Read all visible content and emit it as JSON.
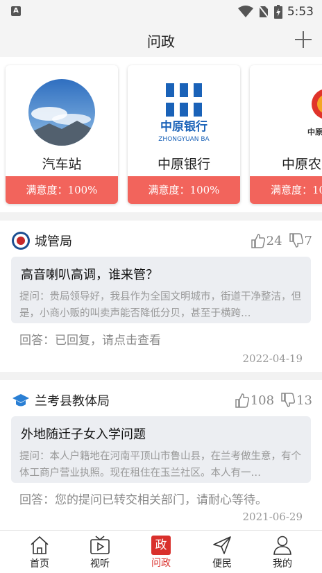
{
  "status": {
    "time": "5:53",
    "left_icon": "A"
  },
  "header": {
    "title": "问政",
    "add_icon": "plus-icon"
  },
  "cards": [
    {
      "name": "汽车站",
      "satisfaction": "满意度：100%",
      "logo": "sky-mountain-photo"
    },
    {
      "name": "中原银行",
      "satisfaction": "满意度：100%",
      "logo": "zhongyuan-bank-logo",
      "logo_text": "中原银行",
      "logo_sub": "ZHONGYUAN BA"
    },
    {
      "name": "中原农",
      "satisfaction": "满意度：10",
      "logo": "zhongyuan-agri-logo",
      "logo_text": "中原农业保"
    }
  ],
  "posts": [
    {
      "department": "城管局",
      "likes": "24",
      "dislikes": "7",
      "question_title": "高音喇叭高调，谁来管？",
      "question_text": "提问：贵局领导好，我县作为全国文明城市，街道干净整洁，但是，小商小贩的叫卖声能否降低分贝，甚至于横跨…",
      "answer": "回答：已回复，请点击查看",
      "date": "2022-04-19"
    },
    {
      "department": "兰考县教体局",
      "likes": "108",
      "dislikes": "13",
      "question_title": "外地随迁子女入学问题",
      "question_text": "提问：本人户籍地在河南平顶山市鲁山县，在兰考做生意，有个体工商户营业执照。现在租住在玉兰社区。本人有一…",
      "answer": "回答：您的提问已转交相关部门，请耐心等待。",
      "date": "2021-06-29"
    }
  ],
  "tabs": [
    {
      "label": "首页",
      "icon": "home-icon"
    },
    {
      "label": "视听",
      "icon": "tv-icon"
    },
    {
      "label": "问政",
      "icon": "zheng-icon",
      "icon_text": "政",
      "active": true
    },
    {
      "label": "便民",
      "icon": "send-icon"
    },
    {
      "label": "我的",
      "icon": "user-icon"
    }
  ],
  "colors": {
    "accent": "#d9302c",
    "satisfaction_bar": "#f2645c",
    "bank_blue": "#1a62b8",
    "agri_red": "#e0332a"
  }
}
